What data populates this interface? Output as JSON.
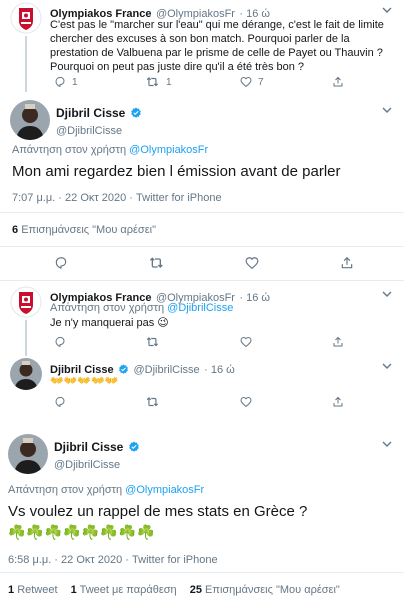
{
  "colors": {
    "accent": "#1da1f2",
    "muted": "#657786",
    "olympiakos_red": "#c8102e"
  },
  "tweet_op_reply": {
    "name": "Olympiakos France",
    "handle": "@OlympiakosFr",
    "time": "· 16 ώ",
    "text": "C'est pas le \"marcher sur l'eau\" qui me dérange, c'est le fait de limite chercher des excuses à son bon match. Pourquoi parler de la prestation de Valbuena par le prisme de celle de Payet ou Thauvin ? Pourquoi on peut pas juste dire qu'il a été très bon ?",
    "reply_count": "1",
    "retweet_count": "1",
    "like_count": "7"
  },
  "main_tweet_1": {
    "name": "Djibril Cisse",
    "handle": "@DjibrilCisse",
    "reply_to_prefix": "Απάντηση στον χρήστη",
    "reply_to_handle": "@OlympiakosFr",
    "text": "Mon ami regardez bien l émission avant de parler",
    "timestamp": "7:07 μ.μ. · 22 Οκτ 2020 · Twitter for iPhone",
    "likes_count": "6",
    "likes_label": "Επισημάνσεις \"Μου αρέσει\""
  },
  "reply_olympiakos": {
    "name": "Olympiakos France",
    "handle": "@OlympiakosFr",
    "time": "· 16 ώ",
    "reply_to_prefix": "Απάντηση στον χρήστη",
    "reply_to_handle": "@DjibrilCisse",
    "text": "Je n'y manquerai pas 😉",
    "reply_count": "",
    "retweet_count": "",
    "like_count": ""
  },
  "reply_cisse": {
    "name": "Djibril Cisse",
    "handle": "@DjibrilCisse",
    "time": "· 16 ώ",
    "text": "👐👐👐👐👐"
  },
  "main_tweet_2": {
    "name": "Djibril Cisse",
    "handle": "@DjibrilCisse",
    "reply_to_prefix": "Απάντηση στον χρήστη",
    "reply_to_handle": "@OlympiakosFr",
    "text": "Vs voulez un rappel de mes stats en Grèce ?",
    "clovers": "☘️☘️☘️☘️☘️☘️☘️☘️",
    "timestamp": "6:58 μ.μ. · 22 Οκτ 2020 · Twitter for iPhone",
    "retweets_count": "1",
    "retweets_label": "Retweet",
    "quotes_count": "1",
    "quotes_label": "Tweet με παράθεση",
    "likes_count": "25",
    "likes_label": "Επισημάνσεις \"Μου αρέσει\""
  }
}
